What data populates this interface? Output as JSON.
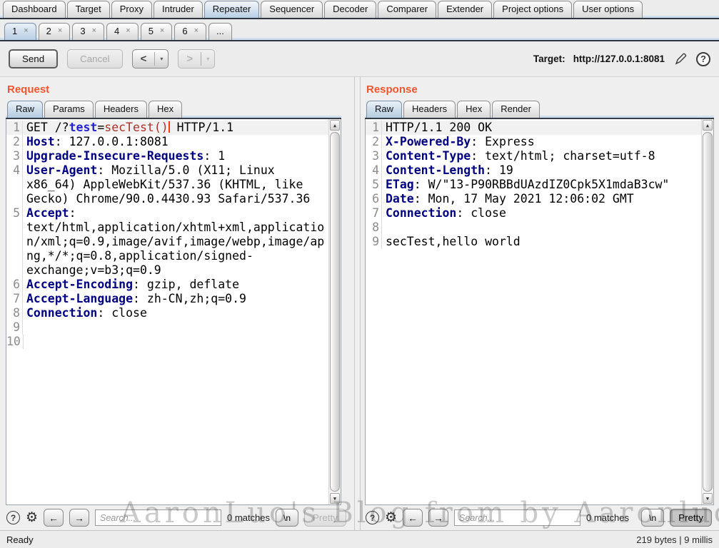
{
  "menubar": {
    "selected": "Repeater",
    "tabs": [
      "Dashboard",
      "Target",
      "Proxy",
      "Intruder",
      "Repeater",
      "Sequencer",
      "Decoder",
      "Comparer",
      "Extender",
      "Project options",
      "User options"
    ]
  },
  "repeater_tabs": {
    "selected": "1",
    "close_glyph": "×",
    "tabs": [
      {
        "label": "1",
        "closable": true
      },
      {
        "label": "2",
        "closable": true
      },
      {
        "label": "3",
        "closable": true
      },
      {
        "label": "4",
        "closable": true
      },
      {
        "label": "5",
        "closable": true
      },
      {
        "label": "6",
        "closable": true
      },
      {
        "label": "...",
        "closable": false
      }
    ]
  },
  "toolbar": {
    "send_label": "Send",
    "cancel_label": "Cancel",
    "prev_glyph": "<",
    "next_glyph": ">",
    "target_label": "Target:",
    "target_url": "http://127.0.0.1:8081"
  },
  "icons": {
    "help": "?",
    "gear": "⚙",
    "back": "←",
    "forward": "→",
    "dropdown": "▾",
    "up": "▲",
    "down": "▼"
  },
  "footer": {
    "search_placeholder": "Search...",
    "matches_label": "0 matches",
    "newline_label": "\\n",
    "pretty_label": "Pretty"
  },
  "request": {
    "title": "Request",
    "tabs": [
      "Raw",
      "Params",
      "Headers",
      "Hex"
    ],
    "selected_tab": "Raw",
    "lines": [
      {
        "n": 1,
        "hl": true,
        "seg": [
          [
            "p",
            "GET /?"
          ],
          [
            "b",
            "test"
          ],
          [
            "p",
            "="
          ],
          [
            "r",
            "secTest()"
          ],
          [
            "cur",
            ""
          ],
          [
            "p",
            " HTTP/1.1"
          ]
        ]
      },
      {
        "n": 2,
        "seg": [
          [
            "h",
            "Host"
          ],
          [
            "p",
            ": 127.0.0.1:8081"
          ]
        ]
      },
      {
        "n": 3,
        "seg": [
          [
            "h",
            "Upgrade-Insecure-Requests"
          ],
          [
            "p",
            ": 1"
          ]
        ]
      },
      {
        "n": 4,
        "seg": [
          [
            "h",
            "User-Agent"
          ],
          [
            "p",
            ": Mozilla/5.0 (X11; Linux x86_64) AppleWebKit/537.36 (KHTML, like Gecko) Chrome/90.0.4430.93 Safari/537.36"
          ]
        ]
      },
      {
        "n": 5,
        "seg": [
          [
            "h",
            "Accept"
          ],
          [
            "p",
            ": text/html,application/xhtml+xml,application/xml;q=0.9,image/avif,image/webp,image/apng,*/*;q=0.8,application/signed-exchange;v=b3;q=0.9"
          ]
        ]
      },
      {
        "n": 6,
        "seg": [
          [
            "h",
            "Accept-Encoding"
          ],
          [
            "p",
            ": gzip, deflate"
          ]
        ]
      },
      {
        "n": 7,
        "seg": [
          [
            "h",
            "Accept-Language"
          ],
          [
            "p",
            ": zh-CN,zh;q=0.9"
          ]
        ]
      },
      {
        "n": 8,
        "seg": [
          [
            "h",
            "Connection"
          ],
          [
            "p",
            ": close"
          ]
        ]
      },
      {
        "n": 9,
        "seg": []
      },
      {
        "n": 10,
        "seg": []
      }
    ]
  },
  "response": {
    "title": "Response",
    "tabs": [
      "Raw",
      "Headers",
      "Hex",
      "Render"
    ],
    "selected_tab": "Raw",
    "lines": [
      {
        "n": 1,
        "hl": true,
        "seg": [
          [
            "p",
            "HTTP/1.1 200 OK"
          ]
        ]
      },
      {
        "n": 2,
        "seg": [
          [
            "h",
            "X-Powered-By"
          ],
          [
            "p",
            ": Express"
          ]
        ]
      },
      {
        "n": 3,
        "seg": [
          [
            "h",
            "Content-Type"
          ],
          [
            "p",
            ": text/html; charset=utf-8"
          ]
        ]
      },
      {
        "n": 4,
        "seg": [
          [
            "h",
            "Content-Length"
          ],
          [
            "p",
            ": 19"
          ]
        ]
      },
      {
        "n": 5,
        "seg": [
          [
            "h",
            "ETag"
          ],
          [
            "p",
            ": W/\"13-P90RBBdUAzdIZ0Cpk5X1mdaB3cw\""
          ]
        ]
      },
      {
        "n": 6,
        "seg": [
          [
            "h",
            "Date"
          ],
          [
            "p",
            ": Mon, 17 May 2021 12:06:02 GMT"
          ]
        ]
      },
      {
        "n": 7,
        "seg": [
          [
            "h",
            "Connection"
          ],
          [
            "p",
            ": close"
          ]
        ]
      },
      {
        "n": 8,
        "seg": []
      },
      {
        "n": 9,
        "seg": [
          [
            "p",
            "secTest,hello world"
          ]
        ]
      }
    ]
  },
  "statusbar": {
    "left": "Ready",
    "right": "219 bytes | 9 millis"
  },
  "watermark": "AaronLuo's Blog from by Aaronluo.github.io",
  "colors": {
    "accent_orange": "#f1552d",
    "header_name_navy": "#000080",
    "param_name_blue": "#2424cc",
    "param_value_red": "#a8332a",
    "cursor_red": "#ff3b00",
    "selected_tab_blue": "#b7cde3",
    "dark_tab_rule": "#2e3540"
  }
}
